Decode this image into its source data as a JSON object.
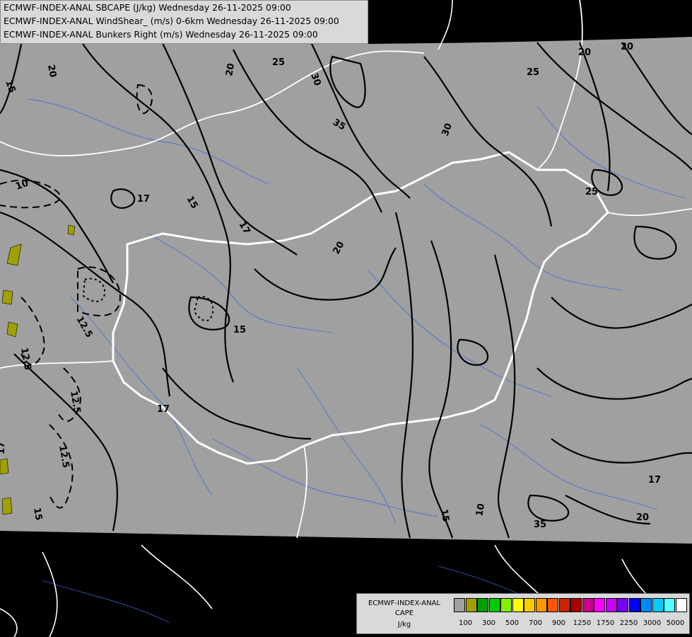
{
  "header": {
    "line1": "ECMWF-INDEX-ANAL SBCAPE (J/kg) Wednesday 26-11-2025 09:00",
    "line2": "ECMWF-INDEX-ANAL WindShear_ (m/s) 0-6km Wednesday 26-11-2025 09:00",
    "line3": "ECMWF-INDEX-ANAL Bunkers Right (m/s) Wednesday 26-11-2025 09:00"
  },
  "legend": {
    "model": "ECMWF-INDEX-ANAL",
    "field": "CAPE",
    "unit": "J/kg",
    "colors": [
      "#a0a0a0",
      "#a0a000",
      "#00a000",
      "#00cc00",
      "#88ee00",
      "#ffff00",
      "#ffcc00",
      "#ff9900",
      "#ff5500",
      "#cc2200",
      "#aa0000",
      "#cc0088",
      "#ff00ff",
      "#cc00ff",
      "#7700ff",
      "#0000ff",
      "#0088ff",
      "#00ccff",
      "#55ffff",
      "#ffffff"
    ],
    "ticks": [
      "100",
      "300",
      "500",
      "700",
      "900",
      "1250",
      "1750",
      "2250",
      "3000",
      "5000"
    ]
  },
  "contour_labels": [
    "20",
    "15",
    "25",
    "30",
    "35",
    "17",
    "10",
    "12.5",
    "15",
    "17",
    "20",
    "17",
    "15",
    "20",
    "30",
    "25",
    "25",
    "20",
    "20",
    "17",
    "20",
    "35",
    "10",
    "12.5",
    "12.5",
    "15",
    "12.5",
    "17",
    "15"
  ],
  "colors": {
    "map_fill": "#a0a0a0",
    "background": "#000000",
    "border": "#ffffff",
    "river": "#3a6ad6",
    "cape_low": "#a0a000"
  }
}
